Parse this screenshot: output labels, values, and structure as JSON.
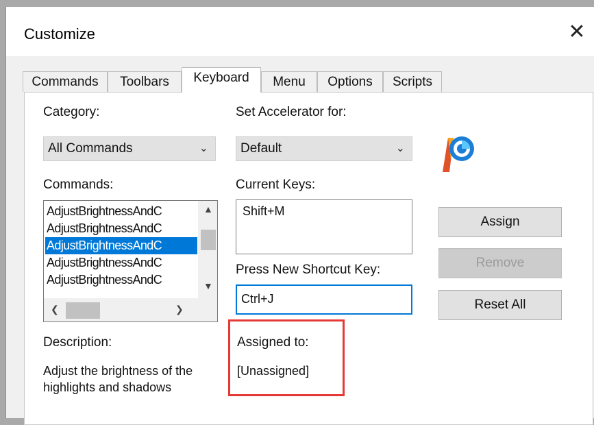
{
  "window": {
    "title": "Customize",
    "close_glyph": "✕"
  },
  "tabs": [
    {
      "label": "Commands"
    },
    {
      "label": "Toolbars"
    },
    {
      "label": "Keyboard",
      "active": true
    },
    {
      "label": "Menu"
    },
    {
      "label": "Options"
    },
    {
      "label": "Scripts"
    }
  ],
  "category": {
    "label": "Category:",
    "selected": "All Commands"
  },
  "accelerator": {
    "label": "Set Accelerator for:",
    "selected": "Default"
  },
  "commands": {
    "label": "Commands:",
    "items": [
      "AdjustBrightnessAndC",
      "AdjustBrightnessAndC",
      "AdjustBrightnessAndC",
      "AdjustBrightnessAndC",
      "AdjustBrightnessAndC"
    ],
    "selected_index": 2
  },
  "current_keys": {
    "label": "Current Keys:",
    "value": "Shift+M"
  },
  "new_shortcut": {
    "label": "Press New Shortcut Key:",
    "value": "Ctrl+J"
  },
  "buttons": {
    "assign": "Assign",
    "remove": "Remove",
    "reset_all": "Reset All"
  },
  "description": {
    "label": "Description:",
    "line1": "Adjust the brightness of the",
    "line2": "highlights and shadows"
  },
  "assigned": {
    "label": "Assigned to:",
    "value": "[Unassigned]"
  },
  "colors": {
    "accent": "#0078d7",
    "highlight_box": "#e53935"
  }
}
